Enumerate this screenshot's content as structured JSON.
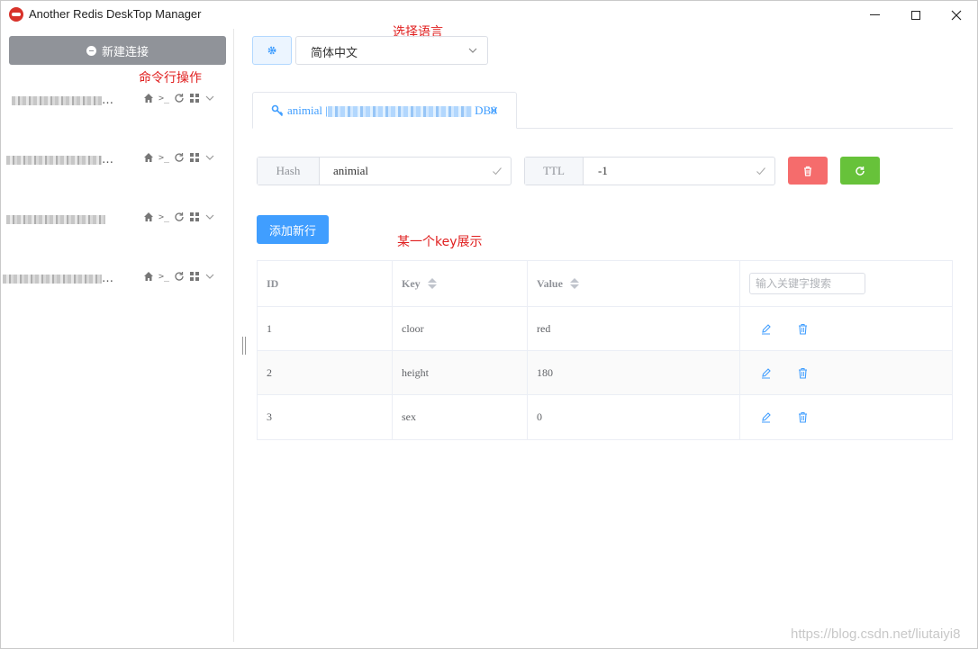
{
  "window": {
    "title": "Another Redis DeskTop Manager"
  },
  "sidebar": {
    "new_connection_label": "新建连接",
    "connections": [
      {
        "name_visible": "…"
      },
      {
        "name_visible": "…"
      },
      {
        "name_visible": ""
      },
      {
        "name_visible": "…"
      }
    ]
  },
  "annotations": {
    "select_language": "选择语言",
    "command_line": "命令行操作",
    "key_display": "某一个key展示"
  },
  "language": {
    "selected": "简体中文"
  },
  "tab": {
    "key_name": "animial",
    "db_label": "DB0",
    "close_glyph": "×"
  },
  "key_info": {
    "type_label": "Hash",
    "key_value": "animial",
    "ttl_label": "TTL",
    "ttl_value": "-1"
  },
  "actions": {
    "add_row_label": "添加新行"
  },
  "table": {
    "columns": [
      "ID",
      "Key",
      "Value"
    ],
    "search_placeholder": "输入关键字搜索",
    "rows": [
      {
        "id": "1",
        "key": "cloor",
        "value": "red"
      },
      {
        "id": "2",
        "key": "height",
        "value": "180"
      },
      {
        "id": "3",
        "key": "sex",
        "value": "0"
      }
    ]
  },
  "watermark": "https://blog.csdn.net/liutaiyi8",
  "colors": {
    "primary": "#409eff",
    "danger": "#f56c6c",
    "success": "#67c23a",
    "annotation": "#e02020",
    "new_connection_bg": "#909399"
  }
}
